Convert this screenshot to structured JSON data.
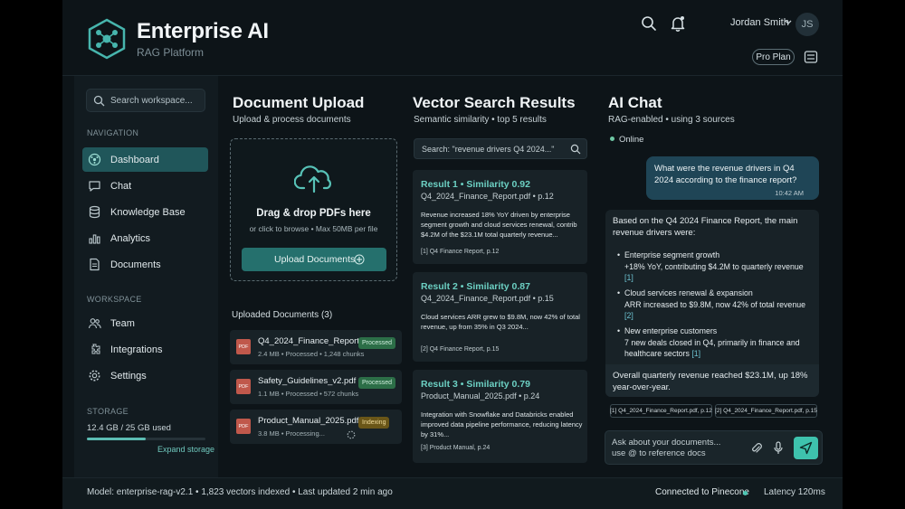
{
  "brand": {
    "title": "Enterprise AI",
    "subtitle": "RAG Platform"
  },
  "header": {
    "user_name": "Jordan Smith",
    "avatar_initials": "JS",
    "plan": "Pro Plan"
  },
  "sidebar": {
    "search_placeholder": "Search workspace...",
    "nav_label": "NAVIGATION",
    "nav_items": [
      {
        "label": "Dashboard",
        "icon": "dashboard-icon",
        "active": true
      },
      {
        "label": "Chat",
        "icon": "chat-icon"
      },
      {
        "label": "Knowledge Base",
        "icon": "knowledge-base-icon"
      },
      {
        "label": "Analytics",
        "icon": "analytics-icon"
      },
      {
        "label": "Documents",
        "icon": "documents-icon"
      }
    ],
    "workspace_label": "WORKSPACE",
    "workspace_items": [
      {
        "label": "Team",
        "icon": "team-icon"
      },
      {
        "label": "Integrations",
        "icon": "integrations-icon"
      },
      {
        "label": "Settings",
        "icon": "settings-icon"
      }
    ],
    "storage_label": "STORAGE",
    "storage_used": "12.4 GB / 25 GB used",
    "storage_fraction": 0.496,
    "expand_storage": "Expand storage"
  },
  "upload": {
    "title": "Document Upload",
    "subtitle": "Upload & process documents",
    "drop_title": "Drag & drop PDFs here",
    "drop_sub": "or click to browse • Max 50MB per file",
    "button": "Upload Documents",
    "uploaded_label": "Uploaded Documents (3)",
    "files": [
      {
        "name": "Q4_2024_Finance_Report.pdf",
        "meta": "2.4 MB • Processed • 1,248 chunks",
        "status": "Processed",
        "icon_text": "PDF"
      },
      {
        "name": "Safety_Guidelines_v2.pdf",
        "meta": "1.1 MB • Processed • 572 chunks",
        "status": "Processed",
        "icon_text": "PDF"
      },
      {
        "name": "Product_Manual_2025.pdf",
        "meta": "3.8 MB • Processing...",
        "status": "Indexing",
        "icon_text": "PDF"
      }
    ]
  },
  "vector": {
    "title": "Vector Search Results",
    "subtitle": "Semantic similarity • top 5 results",
    "query": "Search: \"revenue drivers Q4 2024...\"",
    "results": [
      {
        "title": "Result 1 • Similarity 0.92",
        "file": "Q4_2024_Finance_Report.pdf • p.12",
        "snippet": "Revenue increased 18% YoY driven by enterprise segment growth and cloud services renewal, contrib $4.2M of the $23.1M total quarterly revenue...",
        "citation": "[1] Q4 Finance Report, p.12"
      },
      {
        "title": "Result 2 • Similarity 0.87",
        "file": "Q4_2024_Finance_Report.pdf • p.15",
        "snippet": "Cloud services ARR grew to $9.8M, now 42% of total revenue, up from 35% in Q3 2024...",
        "citation": "[2] Q4 Finance Report, p.15"
      },
      {
        "title": "Result 3 • Similarity 0.79",
        "file": "Product_Manual_2025.pdf • p.24",
        "snippet": "Integration with Snowflake and Databricks enabled improved data pipeline performance, reducing latency by 31%...",
        "citation": "[3] Product Manual, p.24"
      }
    ]
  },
  "chat": {
    "title": "AI Chat",
    "subtitle": "RAG-enabled • using 3 sources",
    "status": "Online",
    "user_message": "What were the revenue drivers in Q4 2024 according to the finance report?",
    "user_time": "10:42 AM",
    "assistant_intro": "Based on the Q4 2024 Finance Report, the main revenue drivers were:",
    "bullets": [
      {
        "head": "Enterprise segment growth",
        "body": "+18% YoY, contributing $4.2M to quarterly revenue",
        "cite": "[1]"
      },
      {
        "head": "Cloud services renewal & expansion",
        "body": "ARR increased to $9.8M, now 42% of total revenue",
        "cite": "[2]"
      },
      {
        "head": "New enterprise customers",
        "body": "7 new deals closed in Q4, primarily in finance and healthcare sectors",
        "cite": "[1]"
      }
    ],
    "summary": "Overall quarterly revenue reached $23.1M, up 18% year-over-year.",
    "sources": [
      "[1] Q4_2024_Finance_Report.pdf, p.12",
      "[2] Q4_2024_Finance_Report.pdf, p.15"
    ],
    "input_line1": "Ask about your documents...",
    "input_line2": "use @ to reference docs"
  },
  "footer": {
    "model": "Model: enterprise-rag-v2.1 • 1,823 vectors indexed • Last updated 2 min ago",
    "connection": "Connected to Pinecone",
    "latency": "Latency 120ms"
  },
  "colors": {
    "accent": "#3ec2ad",
    "active_nav": "#20565a",
    "processed": "#2c6e47",
    "indexing": "#6a5618",
    "background": "#0d1418"
  }
}
